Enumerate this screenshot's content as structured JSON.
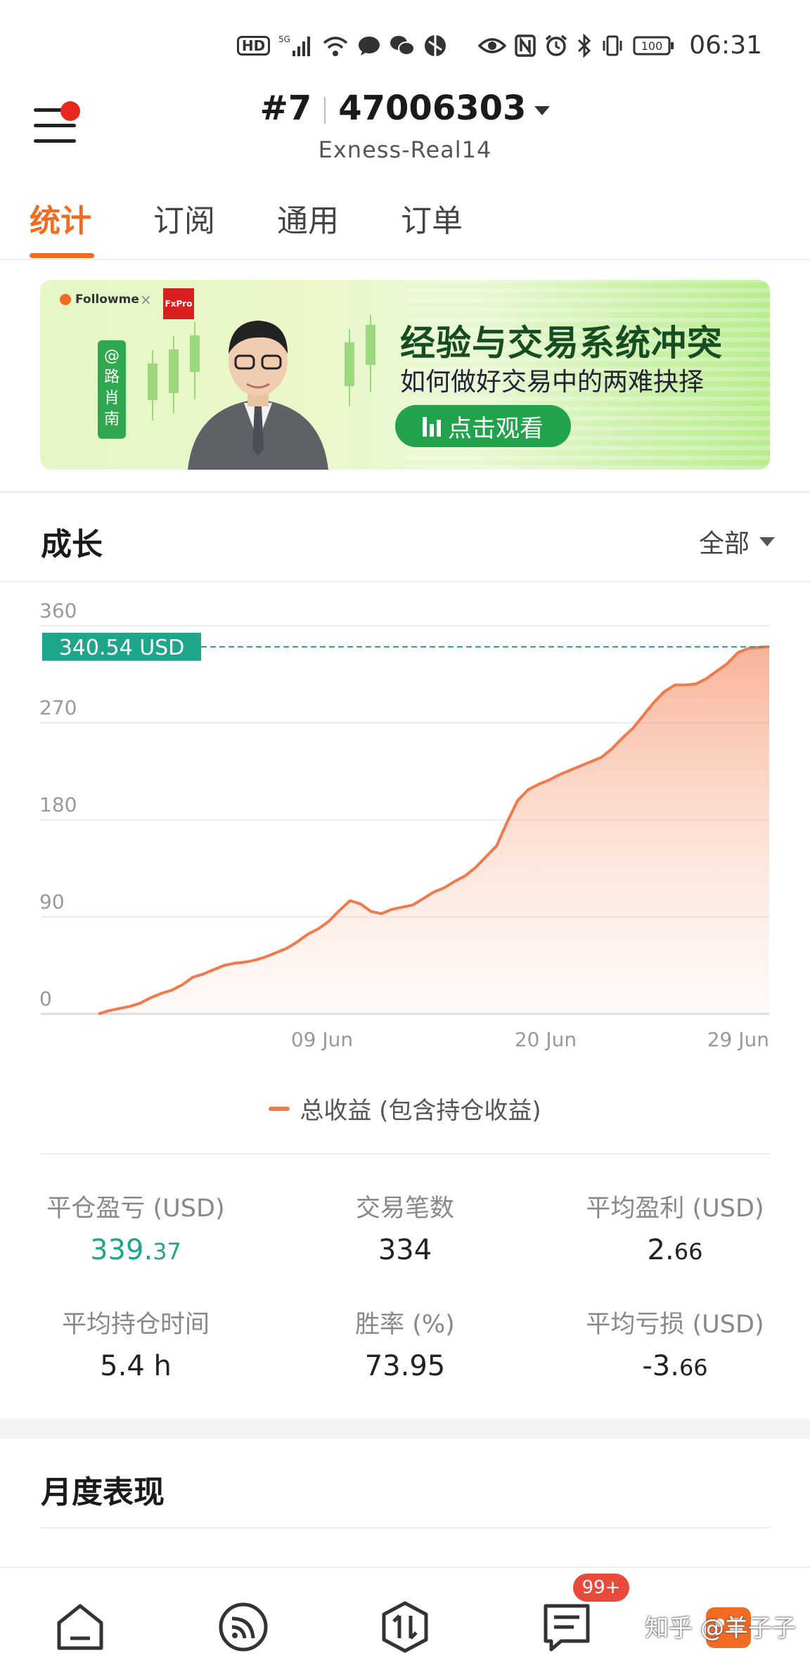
{
  "status_bar": {
    "time": "06:31",
    "battery": "100",
    "icons": [
      "hd-icon",
      "5g-signal-icon",
      "wifi-icon",
      "message-icon",
      "wechat-icon",
      "browser-icon",
      "eye-icon",
      "nfc-icon",
      "alarm-icon",
      "bluetooth-icon",
      "vibrate-icon",
      "battery-icon"
    ]
  },
  "header": {
    "rank": "#7",
    "account_number": "47006303",
    "server": "Exness-Real14"
  },
  "tabs": [
    {
      "label": "统计",
      "active": true
    },
    {
      "label": "订阅",
      "active": false
    },
    {
      "label": "通用",
      "active": false
    },
    {
      "label": "订单",
      "active": false
    }
  ],
  "banner": {
    "brand": "Followme",
    "partner": "FxPro",
    "author": "@路肖南",
    "title": "经验与交易系统冲突",
    "subtitle": "如何做好交易中的两难抉择",
    "cta": "点击观看"
  },
  "growth": {
    "title": "成长",
    "filter": "全部",
    "current_value_label": "340.54 USD",
    "legend": "总收益 (包含持仓收益)"
  },
  "chart_data": {
    "type": "area",
    "title": "",
    "xlabel": "",
    "ylabel": "",
    "ylim": [
      0,
      360
    ],
    "yticks": [
      0,
      90,
      180,
      270,
      360
    ],
    "xticks": [
      "09 Jun",
      "20 Jun",
      "29 Jun"
    ],
    "grid": true,
    "reference_line": 340.54,
    "color": "#f07a4c",
    "series": [
      {
        "name": "总收益 (包含持仓收益)",
        "points": [
          [
            0,
            0
          ],
          [
            1,
            3
          ],
          [
            2,
            5
          ],
          [
            3,
            7
          ],
          [
            4,
            10
          ],
          [
            5,
            15
          ],
          [
            6,
            19
          ],
          [
            7,
            22
          ],
          [
            8,
            27
          ],
          [
            9,
            34
          ],
          [
            10,
            37
          ],
          [
            11,
            41
          ],
          [
            12,
            45
          ],
          [
            13,
            47
          ],
          [
            14,
            48
          ],
          [
            15,
            50
          ],
          [
            16,
            53
          ],
          [
            17,
            57
          ],
          [
            18,
            61
          ],
          [
            19,
            67
          ],
          [
            20,
            74
          ],
          [
            21,
            79
          ],
          [
            22,
            86
          ],
          [
            23,
            96
          ],
          [
            24,
            105
          ],
          [
            25,
            102
          ],
          [
            26,
            95
          ],
          [
            27,
            93
          ],
          [
            28,
            97
          ],
          [
            29,
            99
          ],
          [
            30,
            101
          ],
          [
            31,
            107
          ],
          [
            32,
            113
          ],
          [
            33,
            117
          ],
          [
            34,
            123
          ],
          [
            35,
            128
          ],
          [
            36,
            136
          ],
          [
            37,
            146
          ],
          [
            38,
            156
          ],
          [
            39,
            178
          ],
          [
            40,
            198
          ],
          [
            41,
            208
          ],
          [
            42,
            213
          ],
          [
            43,
            217
          ],
          [
            44,
            222
          ],
          [
            45,
            226
          ],
          [
            46,
            230
          ],
          [
            47,
            234
          ],
          [
            48,
            238
          ],
          [
            49,
            246
          ],
          [
            50,
            256
          ],
          [
            51,
            265
          ],
          [
            52,
            277
          ],
          [
            53,
            289
          ],
          [
            54,
            299
          ],
          [
            55,
            305
          ],
          [
            56,
            305
          ],
          [
            57,
            306
          ],
          [
            58,
            311
          ],
          [
            59,
            318
          ],
          [
            60,
            325
          ],
          [
            61,
            335
          ],
          [
            62,
            339
          ],
          [
            63,
            340
          ],
          [
            64,
            340.54
          ]
        ]
      }
    ]
  },
  "stats": [
    {
      "label": "平仓盈亏 (USD)",
      "value_main": "339.",
      "value_small": "37",
      "color": "green"
    },
    {
      "label": "交易笔数",
      "value_main": "334",
      "value_small": "",
      "color": "default"
    },
    {
      "label": "平均盈利 (USD)",
      "value_main": "2.",
      "value_small": "66",
      "color": "default"
    },
    {
      "label": "平均持仓时间",
      "value_main": "5.4 h",
      "value_small": "",
      "color": "default"
    },
    {
      "label": "胜率 (%)",
      "value_main": "73.95",
      "value_small": "",
      "color": "default"
    },
    {
      "label": "平均亏损 (USD)",
      "value_main": "-3.",
      "value_small": "66",
      "color": "default"
    }
  ],
  "monthly": {
    "title": "月度表现"
  },
  "bottom_nav": {
    "items": [
      "home-icon",
      "feed-icon",
      "trade-icon",
      "messages-icon",
      "profile-icon"
    ],
    "badge": "99+"
  },
  "watermark": "知乎 @羊子子"
}
